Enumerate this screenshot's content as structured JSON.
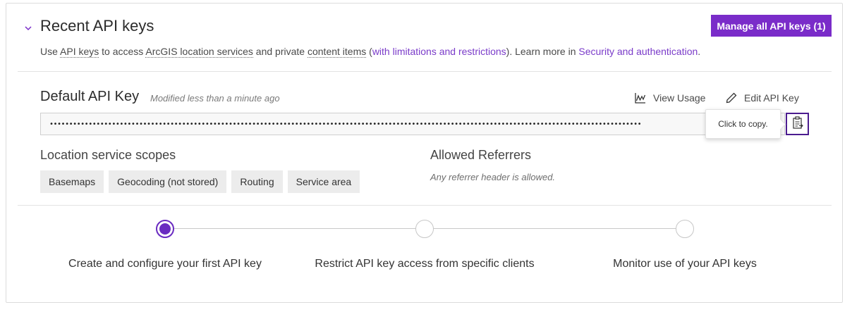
{
  "header": {
    "title": "Recent API keys",
    "manage_button": "Manage all API keys (1)",
    "description": {
      "p1": "Use ",
      "api_keys": "API keys",
      "p2": " to access ",
      "location_services": "ArcGIS location services",
      "p3": " and private ",
      "content_items": "content items",
      "p4": " (",
      "limitations": "with limitations and restrictions",
      "p5": "). Learn more in ",
      "security": "Security and authentication",
      "p6": "."
    }
  },
  "key": {
    "title": "Default API Key",
    "modified": "Modified less than a minute ago",
    "view_usage": "View Usage",
    "edit": "Edit API Key",
    "masked_value": "••••••••••••••••••••••••••••••••••••••••••••••••••••••••••••••••••••••••••••••••••••••••••••••••••••••••••••••••••••••••••••••••••••••••••••••••••••••••",
    "copy_tooltip": "Click to copy."
  },
  "scopes": {
    "label": "Location service scopes",
    "items": [
      "Basemaps",
      "Geocoding (not stored)",
      "Routing",
      "Service area"
    ]
  },
  "referrers": {
    "label": "Allowed Referrers",
    "note": "Any referrer header is allowed."
  },
  "steps": [
    {
      "label": "Create and configure your first API key",
      "state": "active"
    },
    {
      "label": "Restrict API key access from specific clients",
      "state": "inactive"
    },
    {
      "label": "Monitor use of your API keys",
      "state": "inactive"
    }
  ],
  "colors": {
    "accent": "#7a2cc9",
    "link": "#7a3bc9",
    "step_active": "#6a2bc1"
  }
}
